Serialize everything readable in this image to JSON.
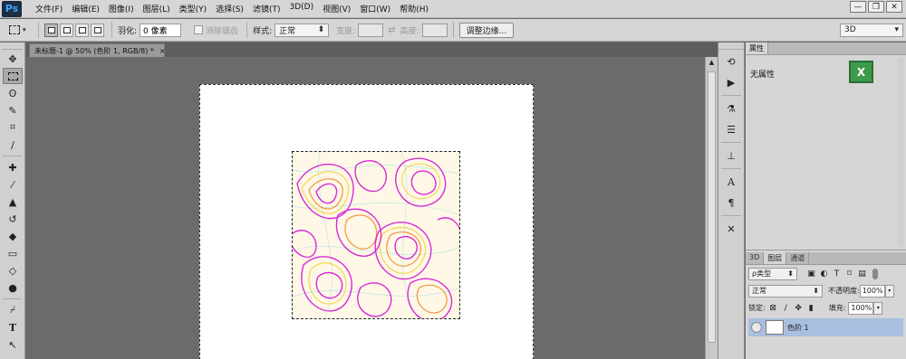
{
  "app": {
    "logo": "Ps"
  },
  "menu": [
    "文件(F)",
    "编辑(E)",
    "图像(I)",
    "图层(L)",
    "类型(Y)",
    "选择(S)",
    "滤镜(T)",
    "3D(D)",
    "视图(V)",
    "窗口(W)",
    "帮助(H)"
  ],
  "window_controls": {
    "minimize": "—",
    "restore": "❐",
    "close": "✕"
  },
  "options": {
    "feather_label": "羽化:",
    "feather_value": "0 像素",
    "antialias_label": "消除锯齿",
    "style_label": "样式:",
    "style_value": "正常",
    "width_label": "宽度:",
    "height_label": "高度:",
    "refine_button": "调整边缘...",
    "workspace": "3D"
  },
  "document_tab": {
    "title": "未标题-1 @ 50% (色阶 1, RGB/8) *",
    "close": "×"
  },
  "panels": {
    "properties_tab": "属性",
    "properties_title": "无属性",
    "layer_tabs": [
      "3D",
      "图层",
      "通道"
    ],
    "kind_label": "ρ类型",
    "blend_mode": "正常",
    "opacity_label": "不透明度:",
    "opacity_value": "100%",
    "lock_label": "锁定:",
    "fill_label": "填充:",
    "fill_value": "100%",
    "layer_name": "色阶 1"
  },
  "colors": {
    "chrome": "#d6d6d6",
    "workspace": "#6b6b6b",
    "contour_magenta": "#d62ad8",
    "contour_orange": "#ee8a2a",
    "contour_yellow": "#f2d23a",
    "contour_cyan": "#7fd8e8"
  },
  "icons": {
    "tools": [
      "move-icon",
      "marquee-icon",
      "lasso-icon",
      "quick-select-icon",
      "crop-icon",
      "eyedropper-icon",
      "healing-icon",
      "brush-icon",
      "stamp-icon",
      "history-brush-icon",
      "eraser-icon",
      "gradient-icon",
      "blur-icon",
      "dodge-icon",
      "pen-icon",
      "type-icon",
      "path-select-icon"
    ],
    "strip": [
      "history-icon",
      "play-icon",
      "adjust-icon",
      "sliders-icon",
      "clone-source-icon",
      "character-icon",
      "paragraph-icon",
      "tools-icon"
    ]
  }
}
